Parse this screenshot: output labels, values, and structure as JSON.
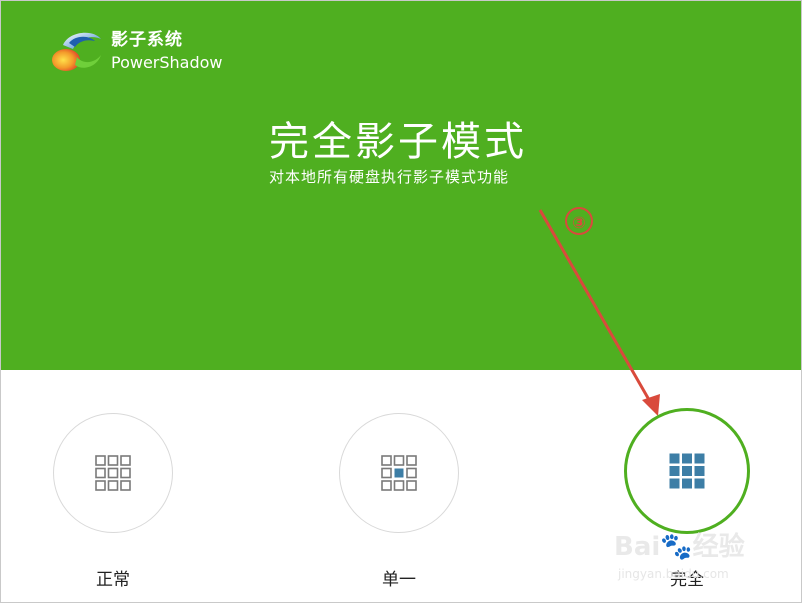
{
  "app": {
    "name": "影子系统",
    "name_en": "PowerShadow",
    "logo_icon": "powershadow-logo-icon"
  },
  "hero": {
    "title": "完全影子模式",
    "subtitle": "对本地所有硬盘执行影子模式功能",
    "background": "#4faf20"
  },
  "annotation": {
    "step_marker": "③",
    "arrow_color": "#d94a3c"
  },
  "modes": [
    {
      "label": "正常",
      "icon": "grid-empty-icon",
      "selected": false
    },
    {
      "label": "单一",
      "icon": "grid-single-icon",
      "selected": false
    },
    {
      "label": "完全",
      "icon": "grid-full-icon",
      "selected": true
    }
  ],
  "colors": {
    "accent": "#4faf20",
    "icon_fill": "#3d7ea6",
    "icon_outline": "#7a7a7a"
  },
  "watermark": {
    "brand": "Bai🐾经验",
    "url": "jingyan.baidu.com"
  }
}
